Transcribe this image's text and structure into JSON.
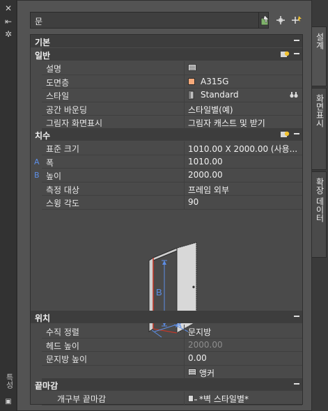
{
  "palette": {
    "title": "특성",
    "selection": "문",
    "left_strip_icons": [
      "close-icon",
      "autohide-icon",
      "settings-icon"
    ]
  },
  "toolbar": {
    "buttons": [
      {
        "name": "select-objects-button",
        "icon": "select-objects-icon"
      },
      {
        "name": "add-button",
        "icon": "crosshair-plus-icon"
      },
      {
        "name": "quick-select-button",
        "icon": "quick-select-icon"
      }
    ]
  },
  "sections": {
    "basic": {
      "label": "기본"
    },
    "general": {
      "label": "일반",
      "rows": [
        {
          "key": "설명",
          "value": "",
          "icon": "description-icon"
        },
        {
          "key": "도면층",
          "value": "A315G",
          "swatch": "#f5a97a"
        },
        {
          "key": "스타일",
          "value": "Standard",
          "icon": "door-style-icon"
        },
        {
          "key": "공간 바운딩",
          "value": "스타일별(예)"
        },
        {
          "key": "그림자 화면표시",
          "value": "그림자 캐스트 및 받기"
        }
      ]
    },
    "dimensions": {
      "label": "치수",
      "rows": [
        {
          "key": "표준 크기",
          "value": "1010.00  X  2000.00 (사용..."
        },
        {
          "key": "폭",
          "value": "1010.00",
          "letter": "A"
        },
        {
          "key": "높이",
          "value": "2000.00",
          "letter": "B"
        },
        {
          "key": "측정 대상",
          "value": "프레임 외부"
        },
        {
          "key": "스윙 각도",
          "value": "90"
        }
      ],
      "diagram_labels": {
        "height": "B",
        "width": "A"
      }
    },
    "location": {
      "label": "위치",
      "rows": [
        {
          "key": "수직 정렬",
          "value": "문지방"
        },
        {
          "key": "헤드 높이",
          "value": "2000.00",
          "dim": true
        },
        {
          "key": "문지방 높이",
          "value": "0.00"
        },
        {
          "key": "",
          "value": "앵커",
          "icon": "anchor-icon"
        }
      ]
    },
    "finish": {
      "label": "끝마감",
      "rows": [
        {
          "key": "개구부 끝마감",
          "value": "*벽 스타일별*",
          "icon": "finish-icon"
        }
      ]
    }
  },
  "tabs": [
    {
      "label": "설계",
      "active": true
    },
    {
      "label": "화면표시",
      "active": false
    },
    {
      "label": "확장 데이터",
      "active": false
    }
  ],
  "colors": {
    "accent_blue": "#5d8ee6",
    "door_red": "#c0392b",
    "layer_swatch": "#f5a97a"
  }
}
